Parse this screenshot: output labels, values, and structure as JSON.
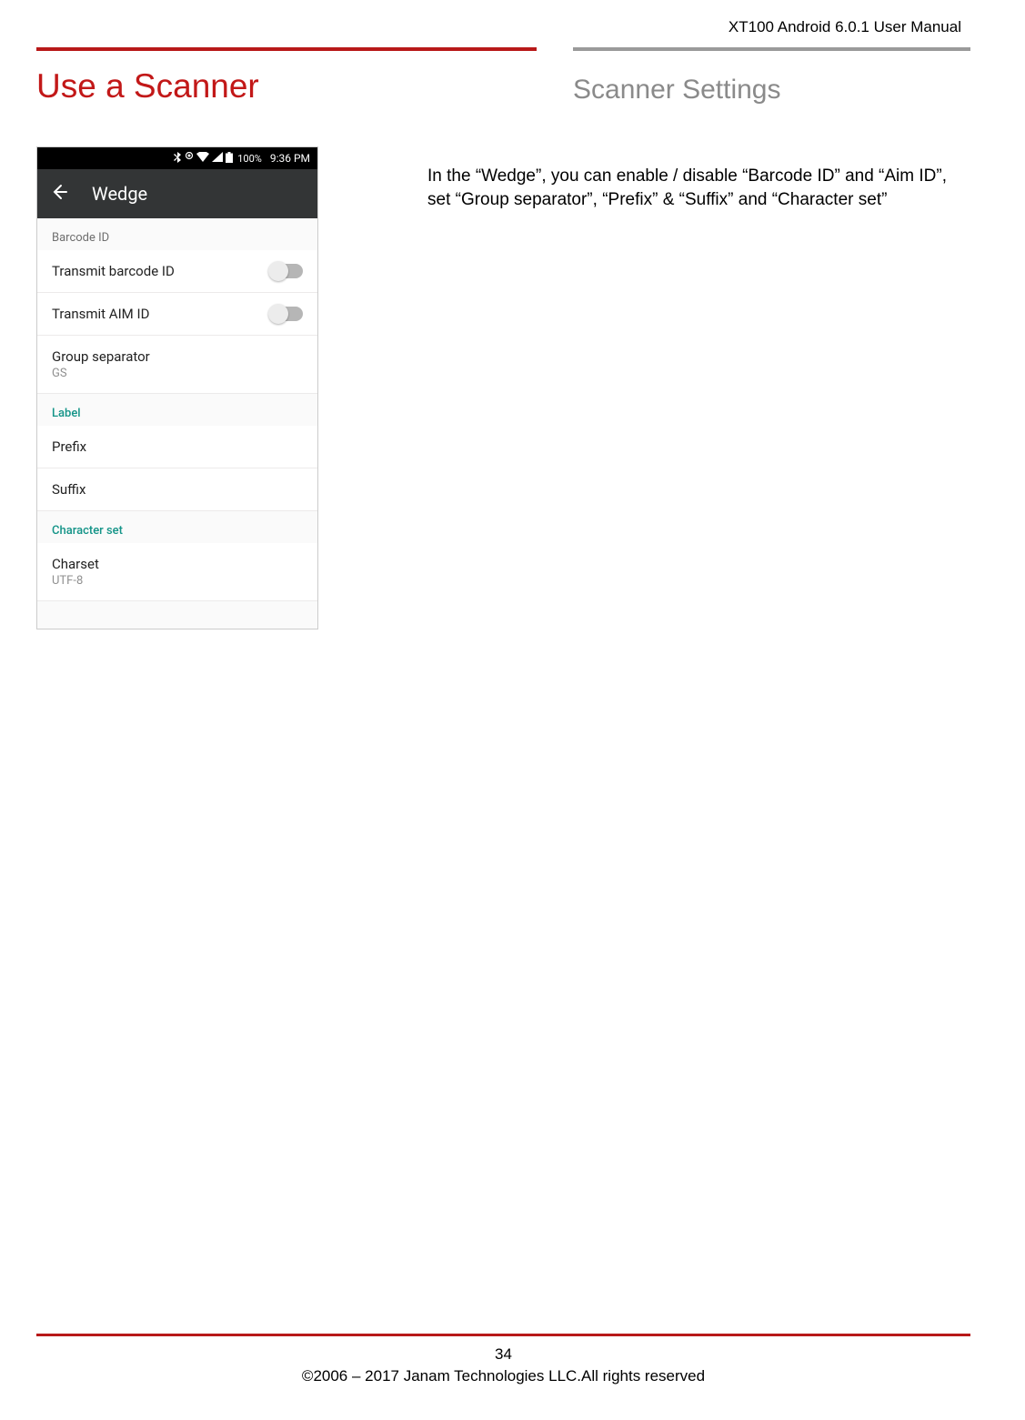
{
  "doc_header": "XT100 Android 6.0.1 User Manual",
  "title_left": "Use a Scanner",
  "title_right": "Scanner Settings",
  "description": "In the “Wedge”, you can enable / disable “Barcode ID” and “Aim ID”, set “Group separator”, “Prefix” & “Suffix” and “Character set”",
  "phone": {
    "status": {
      "battery_text": "100%",
      "time": "9:36 PM"
    },
    "app_title": "Wedge",
    "sections": {
      "barcode_id": {
        "header": "Barcode ID",
        "items": {
          "transmit_barcode": "Transmit barcode ID",
          "transmit_aim": "Transmit AIM ID",
          "group_separator": {
            "primary": "Group separator",
            "secondary": "GS"
          }
        }
      },
      "label": {
        "header": "Label",
        "items": {
          "prefix": "Prefix",
          "suffix": "Suffix"
        }
      },
      "charset": {
        "header": "Character set",
        "items": {
          "charset": {
            "primary": "Charset",
            "secondary": "UTF-8"
          }
        }
      }
    }
  },
  "footer": {
    "page_number": "34",
    "copyright": "©2006 – 2017 Janam Technologies LLC.All rights reserved"
  }
}
